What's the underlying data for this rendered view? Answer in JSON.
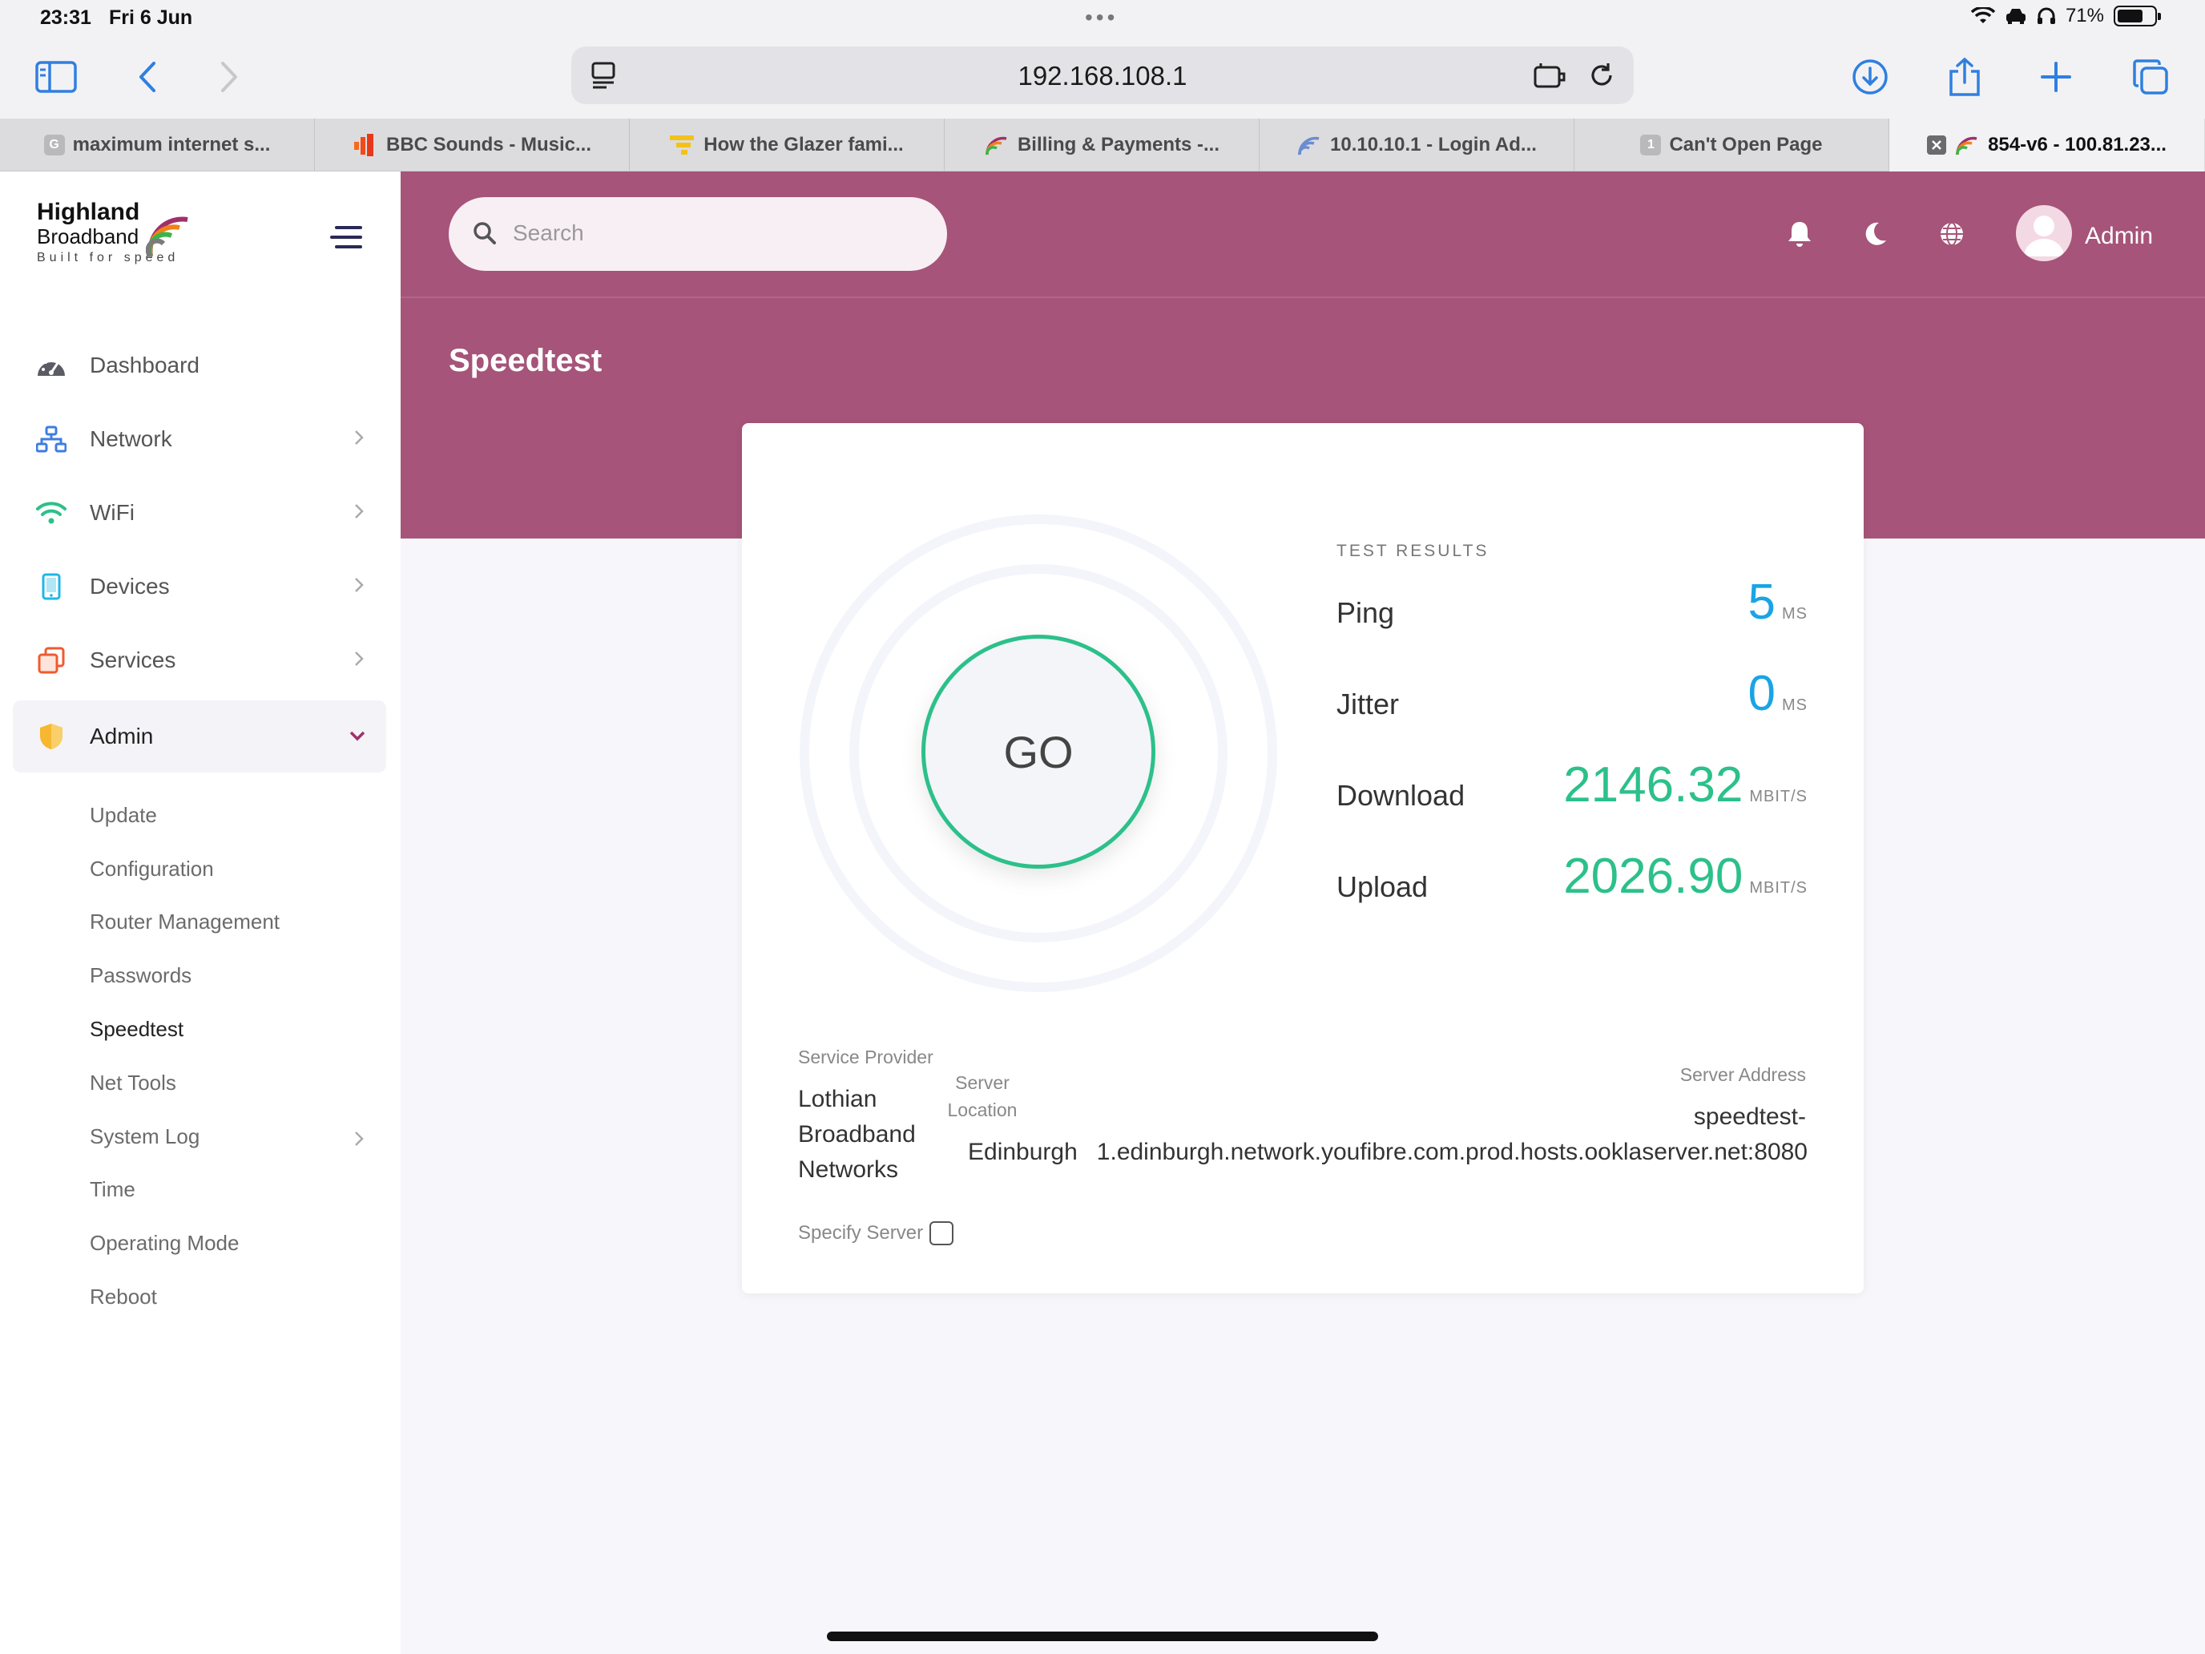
{
  "status_bar": {
    "time": "23:31",
    "date": "Fri 6 Jun",
    "battery": "71%"
  },
  "browser": {
    "url": "192.168.108.1",
    "tabs": [
      {
        "label": "maximum internet s...",
        "favicon_letter": "G"
      },
      {
        "label": "BBC Sounds - Music..."
      },
      {
        "label": "How the Glazer fami..."
      },
      {
        "label": "Billing & Payments -..."
      },
      {
        "label": "10.10.10.1 - Login Ad..."
      },
      {
        "label": "Can't Open Page",
        "favicon_letter": "1"
      },
      {
        "label": "854-v6 - 100.81.23..."
      }
    ]
  },
  "brand": {
    "line1": "Highland",
    "line2": "Broadband",
    "tagline": "Built for speed"
  },
  "sidebar": {
    "items": [
      {
        "label": "Dashboard"
      },
      {
        "label": "Network"
      },
      {
        "label": "WiFi"
      },
      {
        "label": "Devices"
      },
      {
        "label": "Services"
      },
      {
        "label": "Admin"
      }
    ],
    "admin_subitems": [
      {
        "label": "Update"
      },
      {
        "label": "Configuration"
      },
      {
        "label": "Router Management"
      },
      {
        "label": "Passwords"
      },
      {
        "label": "Speedtest"
      },
      {
        "label": "Net Tools"
      },
      {
        "label": "System Log"
      },
      {
        "label": "Time"
      },
      {
        "label": "Operating Mode"
      },
      {
        "label": "Reboot"
      }
    ]
  },
  "header": {
    "search_placeholder": "Search",
    "user": "Admin"
  },
  "page": {
    "title": "Speedtest"
  },
  "speedtest": {
    "go_label": "GO",
    "results_heading": "TEST RESULTS",
    "ping": {
      "label": "Ping",
      "value": "5",
      "unit": "MS"
    },
    "jitter": {
      "label": "Jitter",
      "value": "0",
      "unit": "MS"
    },
    "download": {
      "label": "Download",
      "value": "2146.32",
      "unit": "MBIT/S"
    },
    "upload": {
      "label": "Upload",
      "value": "2026.90",
      "unit": "MBIT/S"
    },
    "service_provider_label": "Service Provider",
    "service_provider_line1": "Lothian",
    "service_provider_line2": "Broadband",
    "service_provider_line3": "Networks",
    "server_location_label_line1": "Server",
    "server_location_label_line2": "Location",
    "server_location": "Edinburgh",
    "server_address_label": "Server Address",
    "server_address_line1": "speedtest-",
    "server_address_line2": "1.edinburgh.network.youfibre.com.prod.hosts.ooklaserver.net:8080",
    "specify_server_label": "Specify Server"
  },
  "colors": {
    "header_bg": "#a65479",
    "accent_green": "#2cc08a",
    "accent_blue": "#1aa4e6"
  }
}
